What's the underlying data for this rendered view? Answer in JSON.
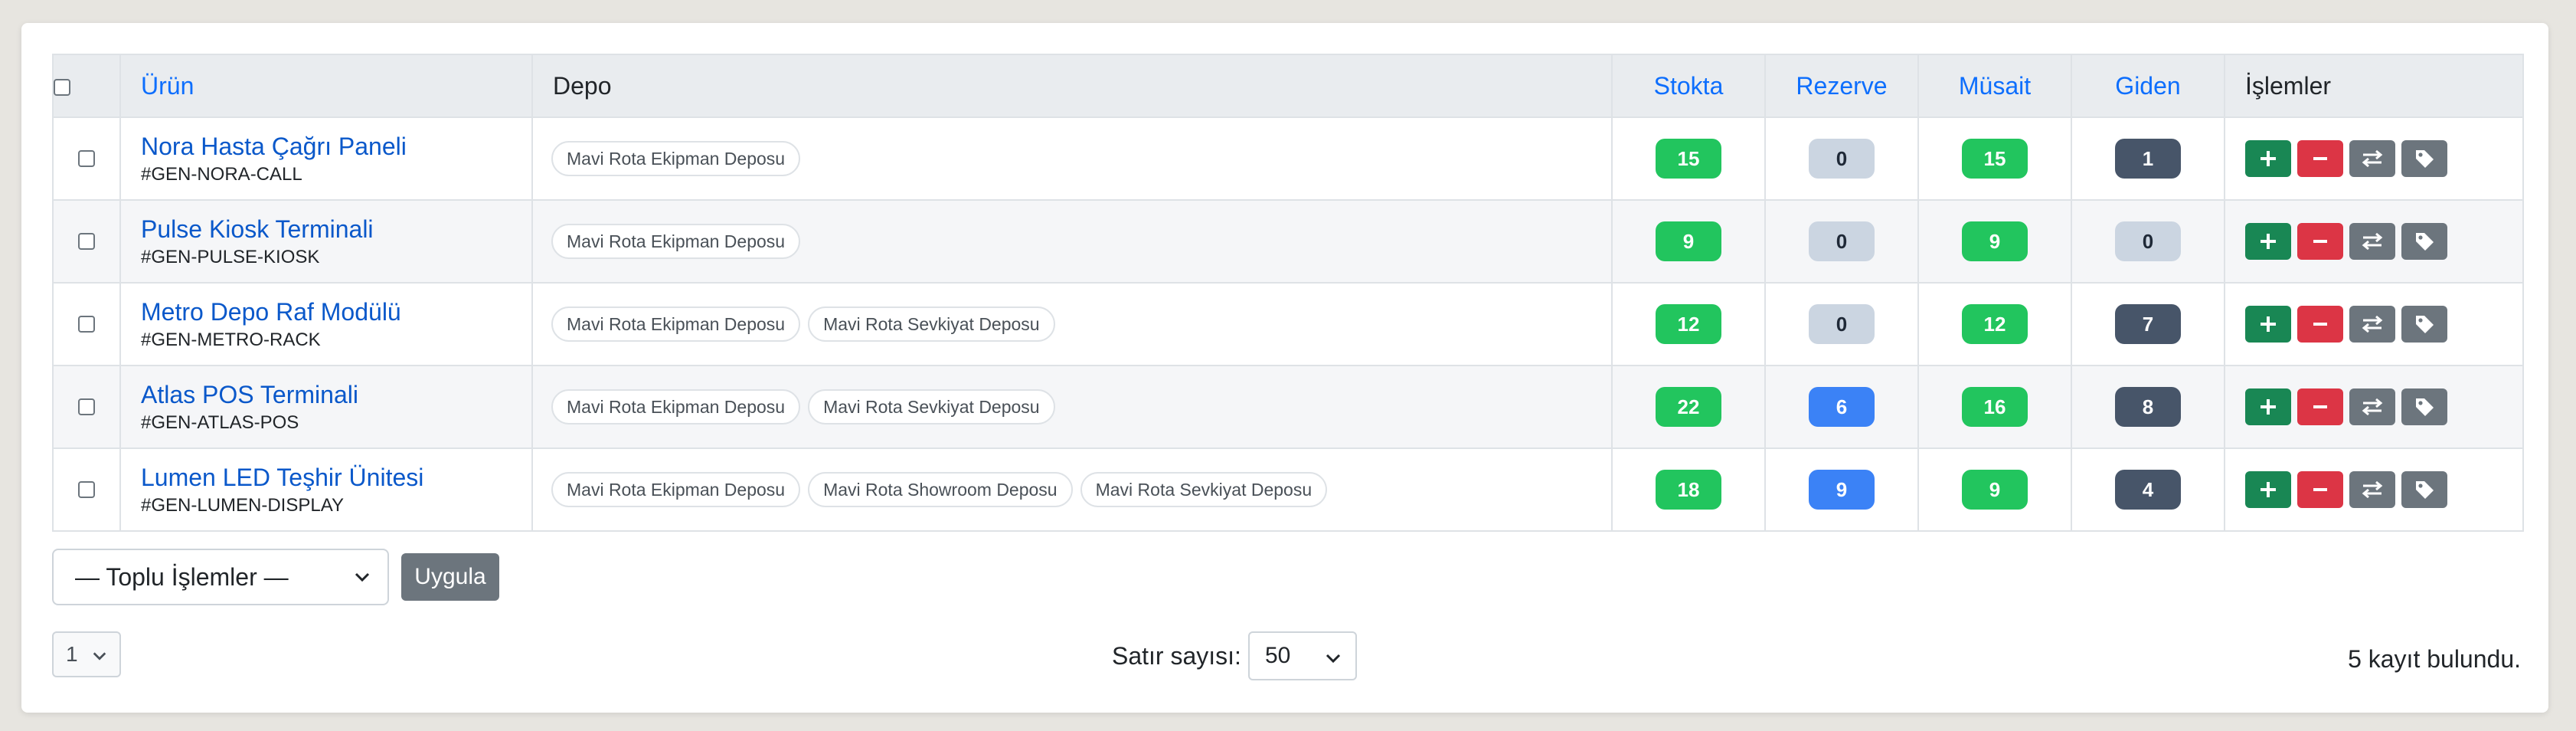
{
  "table": {
    "headers": {
      "urun": "Ürün",
      "depo": "Depo",
      "stokta": "Stokta",
      "rezerve": "Rezerve",
      "musait": "Müsait",
      "giden": "Giden",
      "islemler": "İşlemler"
    },
    "rows": [
      {
        "name": "Nora Hasta Çağrı Paneli",
        "sku": "#GEN-NORA-CALL",
        "depots": [
          "Mavi Rota Ekipman Deposu"
        ],
        "stokta": "15",
        "rezerve": "0",
        "musait": "15",
        "giden": "1"
      },
      {
        "name": "Pulse Kiosk Terminali",
        "sku": "#GEN-PULSE-KIOSK",
        "depots": [
          "Mavi Rota Ekipman Deposu"
        ],
        "stokta": "9",
        "rezerve": "0",
        "musait": "9",
        "giden": "0"
      },
      {
        "name": "Metro Depo Raf Modülü",
        "sku": "#GEN-METRO-RACK",
        "depots": [
          "Mavi Rota Ekipman Deposu",
          "Mavi Rota Sevkiyat Deposu"
        ],
        "stokta": "12",
        "rezerve": "0",
        "musait": "12",
        "giden": "7"
      },
      {
        "name": "Atlas POS Terminali",
        "sku": "#GEN-ATLAS-POS",
        "depots": [
          "Mavi Rota Ekipman Deposu",
          "Mavi Rota Sevkiyat Deposu"
        ],
        "stokta": "22",
        "rezerve": "6",
        "musait": "16",
        "giden": "8"
      },
      {
        "name": "Lumen LED Teşhir Ünitesi",
        "sku": "#GEN-LUMEN-DISPLAY",
        "depots": [
          "Mavi Rota Ekipman Deposu",
          "Mavi Rota Showroom Deposu",
          "Mavi Rota Sevkiyat Deposu"
        ],
        "stokta": "18",
        "rezerve": "9",
        "musait": "9",
        "giden": "4"
      }
    ]
  },
  "bulk": {
    "placeholder": "— Toplu İşlemler —",
    "apply_label": "Uygula"
  },
  "footer": {
    "page": "1",
    "rows_label": "Satır sayısı:",
    "rows_value": "50",
    "total_text": "5 kayıt bulundu."
  },
  "colors": {
    "stock_badge": "#22c55e",
    "reserve_zero": "#cbd5e1",
    "reserve_nonzero": "#3b82f6",
    "outgoing_nonzero": "#475569",
    "add_button": "#198754",
    "remove_button": "#dc3545",
    "neutral_button": "#6c757d",
    "link": "#0a58ca"
  },
  "icons": {
    "add": "plus-icon",
    "remove": "minus-icon",
    "transfer": "transfer-arrows-icon",
    "tag": "tag-icon"
  }
}
